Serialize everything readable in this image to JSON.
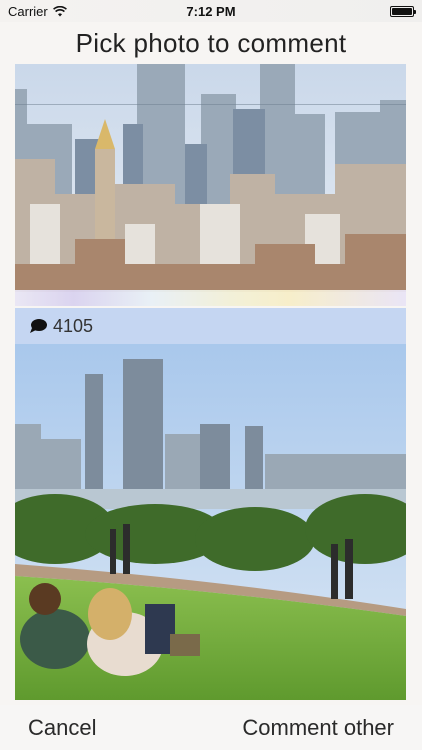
{
  "status_bar": {
    "carrier": "Carrier",
    "time": "7:12 PM",
    "wifi_icon": "wifi-icon",
    "battery_icon": "battery-icon"
  },
  "header": {
    "title": "Pick photo to comment"
  },
  "photos": [
    {
      "subject": "city-skyline-photo"
    },
    {
      "subject": "park-skyline-photo",
      "comment_icon": "speech-bubble-icon",
      "comment_count": "4105"
    }
  ],
  "footer": {
    "cancel_label": "Cancel",
    "comment_other_label": "Comment other"
  },
  "colors": {
    "comment_bar": "#c5d6f2",
    "background": "#f7f5f3"
  }
}
